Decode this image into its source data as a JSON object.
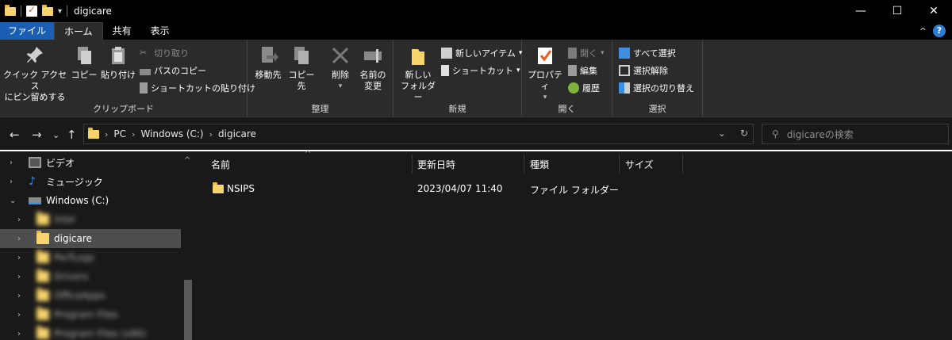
{
  "window": {
    "title": "digicare",
    "controls": {
      "minimize": "—",
      "maximize": "☐",
      "close": "✕"
    }
  },
  "tabs": [
    "ファイル",
    "ホーム",
    "共有",
    "表示"
  ],
  "ribbon": {
    "clipboard": {
      "label": "クリップボード",
      "pin": [
        "クイック アクセス",
        "にピン留めする"
      ],
      "copy": "コピー",
      "paste": "貼り付け",
      "cut": "切り取り",
      "copy_path": "パスのコピー",
      "paste_shortcut": "ショートカットの貼り付け"
    },
    "organize": {
      "label": "整理",
      "move_to": "移動先",
      "copy_to": "コピー先",
      "delete": "削除",
      "rename": [
        "名前の",
        "変更"
      ]
    },
    "new": {
      "label": "新規",
      "new_folder": [
        "新しい",
        "フォルダー"
      ],
      "new_item": "新しいアイテム",
      "shortcut": "ショートカット"
    },
    "open": {
      "label": "開く",
      "properties": "プロパティ",
      "open": "開く",
      "edit": "編集",
      "history": "履歴"
    },
    "select": {
      "label": "選択",
      "select_all": "すべて選択",
      "select_none": "選択解除",
      "invert": "選択の切り替え"
    }
  },
  "address": {
    "crumbs": [
      "PC",
      "Windows (C:)",
      "digicare"
    ],
    "search_placeholder": "digicareの検索"
  },
  "nav": {
    "items": [
      {
        "label": "ビデオ",
        "icon": "video-icon"
      },
      {
        "label": "ミュージック",
        "icon": "music-icon"
      },
      {
        "label": "Windows (C:)",
        "icon": "drive-icon"
      },
      {
        "label": "Intel",
        "icon": "folder-icon"
      },
      {
        "label": "digicare",
        "icon": "folder-icon"
      },
      {
        "label": "PerfLogs",
        "icon": "folder-icon"
      },
      {
        "label": "Drivers",
        "icon": "folder-icon"
      },
      {
        "label": "OfficeApps",
        "icon": "folder-icon"
      },
      {
        "label": "Program Files",
        "icon": "folder-icon"
      },
      {
        "label": "Program Files (x86)",
        "icon": "folder-icon"
      }
    ]
  },
  "files": {
    "columns": [
      "名前",
      "更新日時",
      "種類",
      "サイズ"
    ],
    "rows": [
      {
        "name": "NSIPS",
        "modified": "2023/04/07 11:40",
        "type": "ファイル フォルダー",
        "size": ""
      }
    ]
  },
  "colors": {
    "folder": "#f6d36b",
    "accent": "#1a5fb4",
    "selected": "#4d4d4d"
  }
}
